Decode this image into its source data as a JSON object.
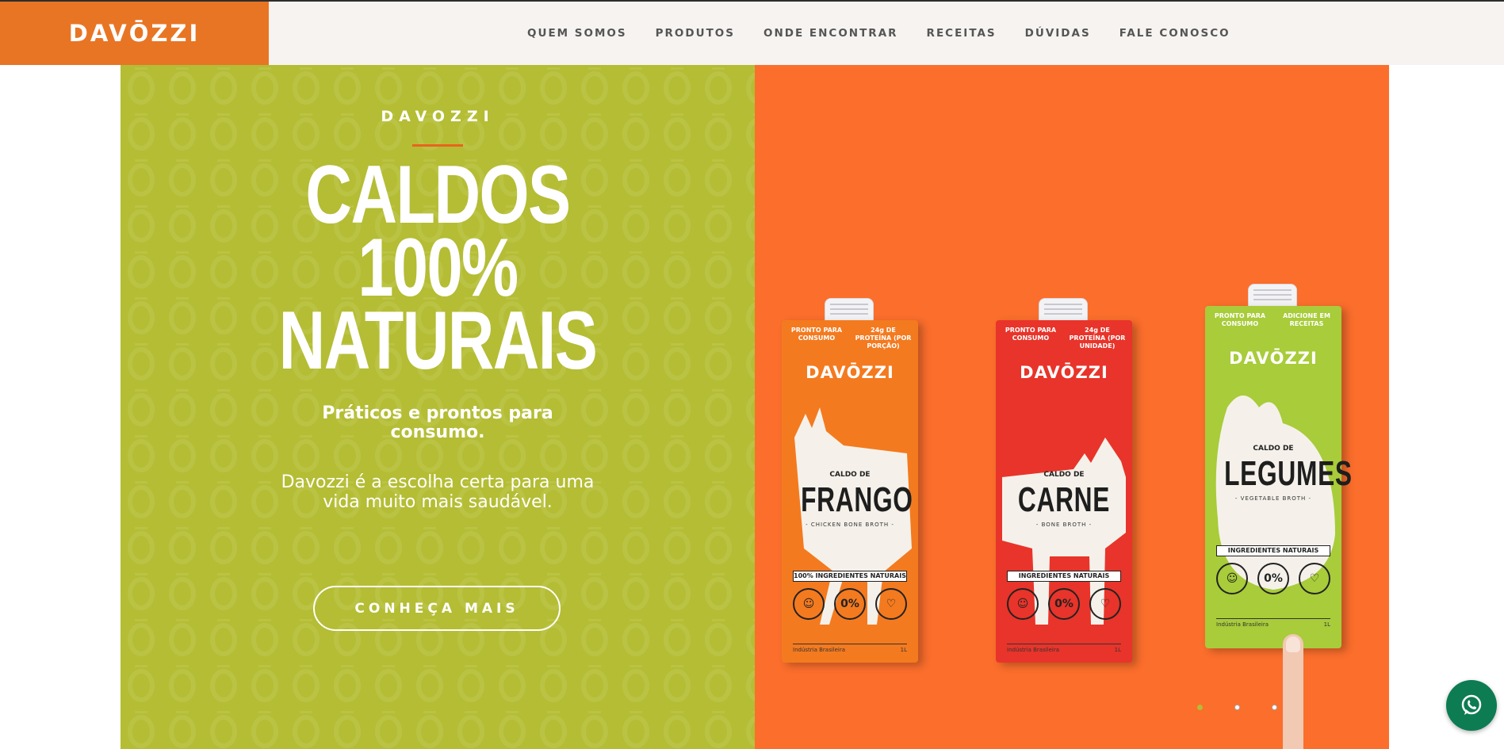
{
  "header": {
    "logo": "DAVŌZZI",
    "nav": [
      "QUEM SOMOS",
      "PRODUTOS",
      "ONDE ENCONTRAR",
      "RECEITAS",
      "DÚVIDAS",
      "FALE CONOSCO"
    ]
  },
  "hero": {
    "eyebrow": "DAVOZZI",
    "headline_line1": "CALDOS",
    "headline_line2": "100%",
    "headline_line3": "NATURAIS",
    "subhead": "Práticos e prontos para consumo.",
    "description": "Davozzi é a escolha certa para uma vida muito mais saudável.",
    "cta": "CONHEÇA MAIS"
  },
  "products": [
    {
      "brand": "DAVŌZZI",
      "tag_left": "PRONTO PARA CONSUMO",
      "tag_right": "24g DE PROTEÍNA (POR PORÇÃO)",
      "caldo_de": "CALDO DE",
      "flavor": "FRANGO",
      "broth": "- CHICKEN BONE BROTH -",
      "ingredients": "100% INGREDIENTES NATURAIS",
      "badge_mid": "0%",
      "footer_left": "Indústria Brasileira",
      "footer_right": "1L",
      "color": "#f47a1f"
    },
    {
      "brand": "DAVŌZZI",
      "tag_left": "PRONTO PARA CONSUMO",
      "tag_right": "24g DE PROTEÍNA (POR UNIDADE)",
      "caldo_de": "CALDO DE",
      "flavor": "CARNE",
      "broth": "- BONE BROTH -",
      "ingredients": "INGREDIENTES NATURAIS",
      "badge_mid": "0%",
      "footer_left": "Indústria Brasileira",
      "footer_right": "1L",
      "color": "#e8342a"
    },
    {
      "brand": "DAVŌZZI",
      "tag_left": "PRONTO PARA CONSUMO",
      "tag_right": "ADICIONE EM RECEITAS",
      "caldo_de": "CALDO DE",
      "flavor": "LEGUMES",
      "broth": "- VEGETABLE BROTH -",
      "ingredients": "INGREDIENTES NATURAIS",
      "badge_mid": "0%",
      "footer_left": "Indústria Brasileira",
      "footer_right": "1L",
      "color": "#a8cc3a"
    }
  ],
  "slider": {
    "count": 3,
    "active": 0
  },
  "colors": {
    "brand_orange": "#e87524",
    "hero_green": "#b4bd34",
    "hero_orange": "#fb6e2c",
    "whatsapp_green": "#0d7c52"
  },
  "icons": {
    "whatsapp": "whatsapp-icon"
  }
}
